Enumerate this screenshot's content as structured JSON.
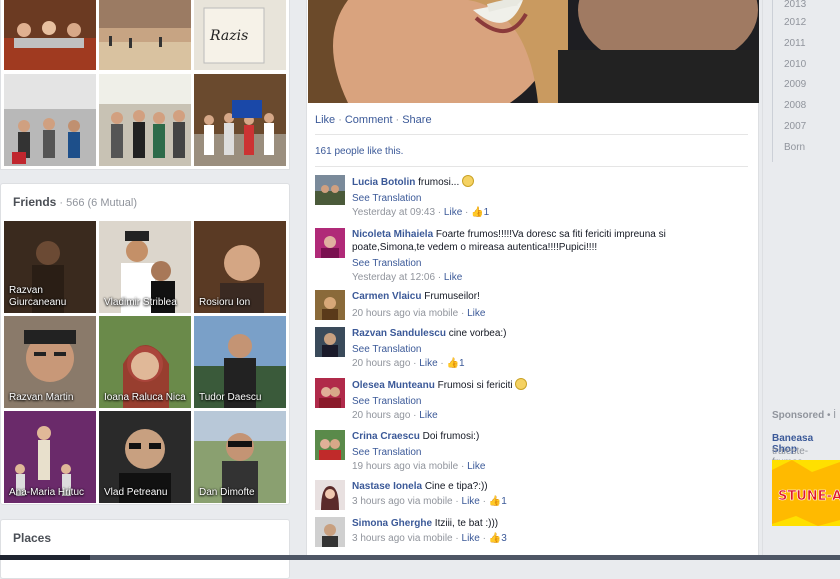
{
  "friends": {
    "title": "Friends",
    "count": "566 (6 Mutual)",
    "items": [
      {
        "name": "Razvan Giurcaneanu"
      },
      {
        "name": "Vladimir Striblea"
      },
      {
        "name": "Rosioru Ion"
      },
      {
        "name": "Razvan Martin"
      },
      {
        "name": "Ioana Raluca Nica"
      },
      {
        "name": "Tudor Daescu"
      },
      {
        "name": "Ana-Maria Hrituc"
      },
      {
        "name": "Vlad Petreanu"
      },
      {
        "name": "Dan Dimofte"
      }
    ]
  },
  "places": {
    "title": "Places"
  },
  "post": {
    "actions": {
      "like": "Like",
      "comment": "Comment",
      "share": "Share"
    },
    "likes_text": "161 people like this."
  },
  "comments": [
    {
      "author": "Lucia Botolin",
      "text": "frumosi...",
      "smiley": true,
      "see": "See Translation",
      "time": "Yesterday at 09:43",
      "like": "Like",
      "likes": "1"
    },
    {
      "author": "Nicoleta Mihaiela",
      "text": "Foarte frumos!!!!!Va doresc sa fiti fericiti impreuna si poate,Simona,te vedem o mireasa autentica!!!!Pupici!!!!",
      "smiley": false,
      "see": "See Translation",
      "time": "Yesterday at 12:06",
      "like": "Like",
      "likes": ""
    },
    {
      "author": "Carmen Vlaicu",
      "text": "Frumuseilor!",
      "smiley": false,
      "see": "",
      "time": "20 hours ago via mobile",
      "like": "Like",
      "likes": ""
    },
    {
      "author": "Razvan Sandulescu",
      "text": "cine vorbea:)",
      "smiley": false,
      "see": "See Translation",
      "time": "20 hours ago",
      "like": "Like",
      "likes": "1"
    },
    {
      "author": "Olesea Munteanu",
      "text": "Frumosi si fericiti",
      "smiley": true,
      "see": "See Translation",
      "time": "20 hours ago",
      "like": "Like",
      "likes": ""
    },
    {
      "author": "Crina Craescu",
      "text": "Doi frumosi:)",
      "smiley": false,
      "see": "See Translation",
      "time": "19 hours ago via mobile",
      "like": "Like",
      "likes": ""
    },
    {
      "author": "Nastase Ionela",
      "text": "Cine e tipa?:))",
      "smiley": false,
      "see": "",
      "time": "3 hours ago via mobile",
      "like": "Like",
      "likes": "1"
    },
    {
      "author": "Simona Gherghe",
      "text": "Itziii, te bat :)))",
      "smiley": false,
      "see": "",
      "time": "3 hours ago via mobile",
      "like": "Like",
      "likes": "3"
    }
  ],
  "timeline_years": [
    "2013",
    "2012",
    "2011",
    "2010",
    "2009",
    "2008",
    "2007",
    "Born"
  ],
  "sponsored": {
    "label": "Sponsored",
    "suffix": "• İ",
    "ad_title": "Baneasa Shop",
    "ad_url": "traieste-frumos.",
    "ad_img_text": "STUNE-A"
  }
}
